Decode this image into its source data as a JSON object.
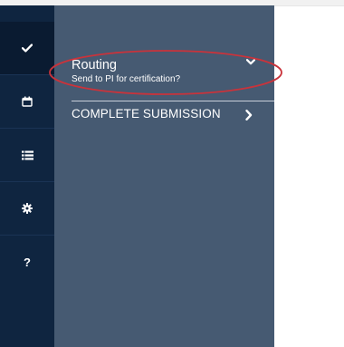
{
  "rail": {
    "items": [
      {
        "name": "check-icon",
        "active": true
      },
      {
        "name": "calendar-icon",
        "active": false
      },
      {
        "name": "list-icon",
        "active": false
      },
      {
        "name": "gear-icon",
        "active": false
      },
      {
        "name": "help-icon",
        "label": "?",
        "active": false
      }
    ]
  },
  "panel": {
    "routing": {
      "title": "Routing",
      "subtitle": "Send to PI for certification?",
      "chevron": "chevron-down-icon"
    },
    "complete": {
      "label": "COMPLETE SUBMISSION",
      "chevron": "chevron-right-icon"
    }
  },
  "colors": {
    "rail_bg": "#0f2540",
    "panel_bg": "#465a72",
    "highlight": "#c9333b"
  }
}
